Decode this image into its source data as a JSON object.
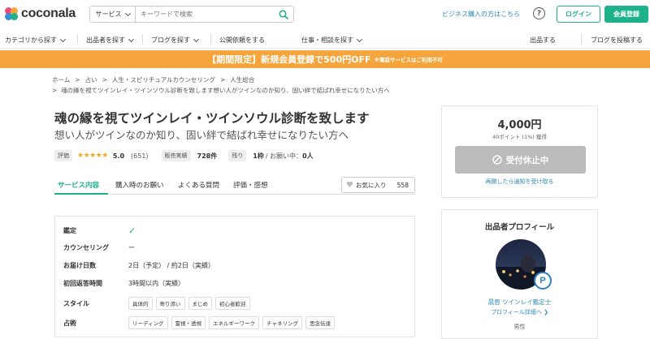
{
  "header": {
    "logo_text": "coconala",
    "search_category": "サービス",
    "search_placeholder": "キーワードで検索",
    "business_link": "ビジネス購入の方はこちら",
    "help": "?",
    "login": "ログイン",
    "signup": "会員登録"
  },
  "nav": {
    "items": [
      "カテゴリから探す",
      "出品者を探す",
      "ブログを探す",
      "公開依頼をする",
      "仕事・相談を探す",
      "出品する",
      "ブログを投稿する"
    ]
  },
  "banner": {
    "main": "【期間限定】新規会員登録で500円OFF",
    "note": "※電話サービスはご利用不可"
  },
  "breadcrumb": {
    "items": [
      "ホーム",
      "占い",
      "人生・スピリチュアルカウンセリング",
      "人生総合"
    ],
    "current": "魂の縁を視てツインレイ・ツインソウル診断を致します想い人がツインなのか知り、固い絆で結ばれ幸せになりたい方へ"
  },
  "service": {
    "title": "魂の縁を視てツインレイ・ツインソウル診断を致します",
    "subtitle": "想い人がツインなのか知り、固い絆で結ばれ幸せになりたい方へ",
    "rating_label": "評価",
    "stars": "★★★★★",
    "rating": "5.0",
    "review_count": "(651)",
    "sales_label": "販売実績",
    "sales": "728件",
    "remaining_label": "残り",
    "remaining": "1枠",
    "inquiring_label": "/ お願い中：",
    "inquiring": "0人"
  },
  "tabs": [
    "サービス内容",
    "購入時のお願い",
    "よくある質問",
    "評価・感想"
  ],
  "favorite": {
    "label": "お気に入り",
    "count": "558"
  },
  "details": {
    "rows": [
      {
        "label": "鑑定",
        "value": "✓"
      },
      {
        "label": "カウンセリング",
        "value": "ー"
      },
      {
        "label": "お届け日数",
        "value": "2日（予定） / 約2日（実績）"
      },
      {
        "label": "初回返答時間",
        "value": "3時間以内（実績）"
      }
    ],
    "style_label": "スタイル",
    "style_chips": [
      "具体的",
      "寄り添い",
      "まじめ",
      "初心者歓迎"
    ],
    "divination_label": "占術",
    "divination_chips": [
      "リーディング",
      "霊視・透視",
      "エネルギーワーク",
      "チャネリング",
      "思念伝達"
    ]
  },
  "price_card": {
    "price": "4,000円",
    "points": "40ポイント (1%) 獲得",
    "stop_label": "受付休止中",
    "notify": "再開したら通知を受け取る"
  },
  "profile": {
    "title": "出品者プロフィール",
    "badge": "P",
    "name": "晨恩 ツインレイ鑑定士",
    "detail_link": "プロフィール詳細へ",
    "gender": "男性"
  }
}
